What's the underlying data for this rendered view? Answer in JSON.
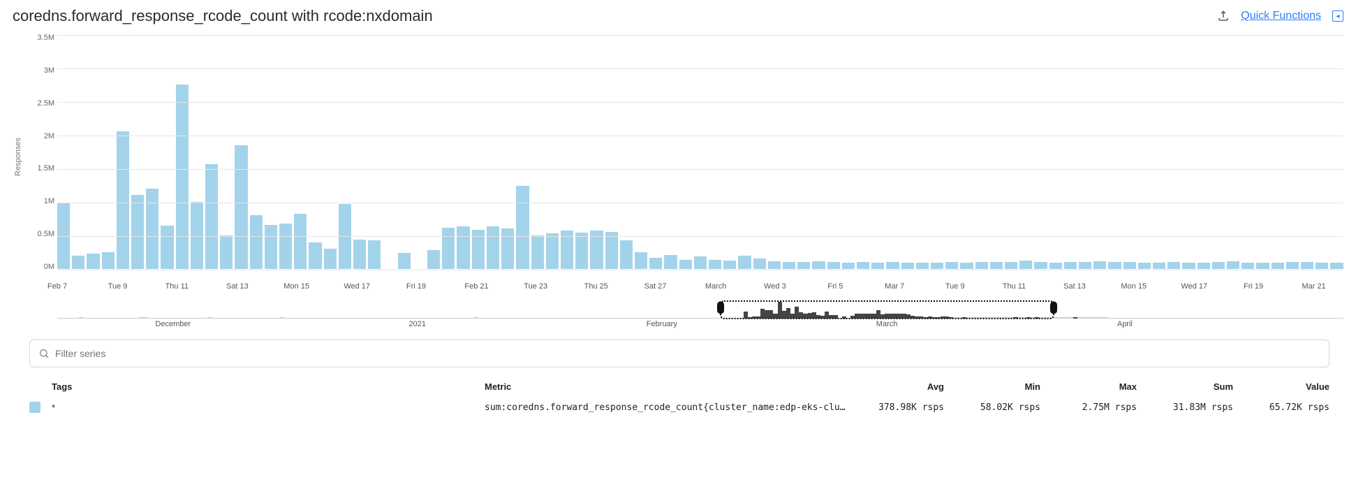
{
  "header": {
    "title": "coredns.forward_response_rcode_count with rcode:nxdomain",
    "quick_functions": "Quick Functions"
  },
  "filter": {
    "placeholder": "Filter series"
  },
  "table": {
    "headers": {
      "tags": "Tags",
      "metric": "Metric",
      "avg": "Avg",
      "min": "Min",
      "max": "Max",
      "sum": "Sum",
      "value": "Value"
    },
    "row": {
      "tags": "*",
      "metric": "sum:coredns.forward_response_rcode_count{cluster_name:edp-eks-cluster-d...",
      "avg": "378.98K rsps",
      "min": "58.02K rsps",
      "max": "2.75M rsps",
      "sum": "31.83M rsps",
      "value": "65.72K rsps"
    }
  },
  "chart_data": {
    "type": "bar",
    "ylabel": "Responses",
    "ylim": [
      0,
      3500000
    ],
    "y_ticks": [
      "0M",
      "0.5M",
      "1M",
      "1.5M",
      "2M",
      "2.5M",
      "3M",
      "3.5M"
    ],
    "x_ticks": [
      {
        "pos": 0.0,
        "label": "Feb 7"
      },
      {
        "pos": 0.047,
        "label": "Tue 9"
      },
      {
        "pos": 0.093,
        "label": "Thu 11"
      },
      {
        "pos": 0.14,
        "label": "Sat 13"
      },
      {
        "pos": 0.186,
        "label": "Mon 15"
      },
      {
        "pos": 0.233,
        "label": "Wed 17"
      },
      {
        "pos": 0.279,
        "label": "Fri 19"
      },
      {
        "pos": 0.326,
        "label": "Feb 21"
      },
      {
        "pos": 0.372,
        "label": "Tue 23"
      },
      {
        "pos": 0.419,
        "label": "Thu 25"
      },
      {
        "pos": 0.465,
        "label": "Sat 27"
      },
      {
        "pos": 0.512,
        "label": "March"
      },
      {
        "pos": 0.558,
        "label": "Wed 3"
      },
      {
        "pos": 0.605,
        "label": "Fri 5"
      },
      {
        "pos": 0.651,
        "label": "Mar 7"
      },
      {
        "pos": 0.698,
        "label": "Tue 9"
      },
      {
        "pos": 0.744,
        "label": "Thu 11"
      },
      {
        "pos": 0.791,
        "label": "Sat 13"
      },
      {
        "pos": 0.837,
        "label": "Mon 15"
      },
      {
        "pos": 0.884,
        "label": "Wed 17"
      },
      {
        "pos": 0.93,
        "label": "Fri 19"
      },
      {
        "pos": 0.977,
        "label": "Mar 21"
      }
    ],
    "values": [
      980000,
      200000,
      230000,
      250000,
      2050000,
      1100000,
      1200000,
      650000,
      2750000,
      1000000,
      1560000,
      500000,
      1840000,
      800000,
      660000,
      680000,
      820000,
      400000,
      300000,
      970000,
      440000,
      430000,
      0,
      240000,
      0,
      280000,
      610000,
      640000,
      580000,
      640000,
      600000,
      1240000,
      500000,
      530000,
      570000,
      540000,
      570000,
      550000,
      430000,
      250000,
      170000,
      210000,
      140000,
      190000,
      140000,
      130000,
      200000,
      160000,
      110000,
      100000,
      100000,
      110000,
      100000,
      90000,
      100000,
      90000,
      100000,
      90000,
      90000,
      95000,
      100000,
      95000,
      100000,
      100000,
      105000,
      120000,
      100000,
      95000,
      105000,
      100000,
      110000,
      105000,
      100000,
      95000,
      95000,
      100000,
      95000,
      95000,
      100000,
      110000,
      95000,
      90000,
      95000,
      100000,
      100000,
      95000,
      95000
    ],
    "overview": {
      "x_ticks": [
        {
          "pos": 0.09,
          "label": "December"
        },
        {
          "pos": 0.28,
          "label": "2021"
        },
        {
          "pos": 0.47,
          "label": "February"
        },
        {
          "pos": 0.645,
          "label": "March"
        },
        {
          "pos": 0.83,
          "label": "April"
        }
      ],
      "selection": {
        "left_pct": 51.5,
        "right_pct": 77.5
      },
      "values": [
        5,
        5,
        6,
        5,
        5,
        7,
        6,
        5,
        6,
        5,
        6,
        5,
        5,
        6,
        5,
        5,
        6,
        5,
        5,
        7,
        8,
        6,
        5,
        6,
        5,
        5,
        6,
        5,
        5,
        6,
        5,
        5,
        6,
        5,
        5,
        7,
        6,
        5,
        6,
        5,
        5,
        6,
        5,
        5,
        6,
        5,
        6,
        5,
        5,
        6,
        5,
        5,
        7,
        6,
        5,
        6,
        5,
        5,
        6,
        5,
        5,
        6,
        5,
        6,
        5,
        5,
        6,
        5,
        5,
        6,
        5,
        5,
        6,
        5,
        5,
        6,
        5,
        6,
        5,
        5,
        6,
        5,
        5,
        6,
        5,
        5,
        6,
        5,
        6,
        5,
        5,
        6,
        5,
        5,
        6,
        5,
        5,
        7,
        6,
        5,
        6,
        5,
        5,
        6,
        5,
        5,
        6,
        5,
        6,
        5,
        5,
        6,
        5,
        5,
        6,
        5,
        5,
        6,
        5,
        5,
        6,
        5,
        6,
        5,
        5,
        6,
        5,
        5,
        6,
        5,
        5,
        6,
        5,
        6,
        5,
        5,
        6,
        5,
        5,
        6,
        5,
        5,
        6,
        5,
        6,
        5,
        5,
        6,
        5,
        5,
        6,
        5,
        5,
        6,
        5,
        6,
        5,
        5,
        6,
        5,
        40,
        10,
        12,
        14,
        60,
        48,
        52,
        30,
        100,
        45,
        62,
        28,
        72,
        38,
        30,
        32,
        36,
        20,
        16,
        42,
        22,
        22,
        2,
        14,
        2,
        16,
        28,
        30,
        28,
        30,
        28,
        52,
        26,
        28,
        30,
        28,
        30,
        28,
        24,
        16,
        12,
        14,
        10,
        12,
        10,
        10,
        14,
        12,
        9,
        8,
        8,
        9,
        8,
        8,
        8,
        8,
        8,
        8,
        8,
        8,
        8,
        8,
        8,
        9,
        8,
        8,
        9,
        8,
        9,
        8,
        8,
        8,
        8,
        8,
        8,
        8,
        8,
        9,
        8,
        8,
        8,
        8,
        8,
        8,
        8,
        5,
        5,
        4,
        5,
        5,
        6,
        5,
        5,
        6,
        5,
        5,
        6,
        5,
        6,
        5,
        5,
        6,
        5,
        5,
        6,
        5,
        5,
        6,
        5,
        6,
        5,
        5,
        6,
        5,
        5,
        6,
        5,
        5,
        6,
        5,
        6,
        5,
        5,
        6,
        5,
        5,
        6,
        5,
        5,
        6,
        5,
        6,
        5,
        5,
        6,
        5,
        5,
        6,
        5,
        5
      ]
    }
  }
}
